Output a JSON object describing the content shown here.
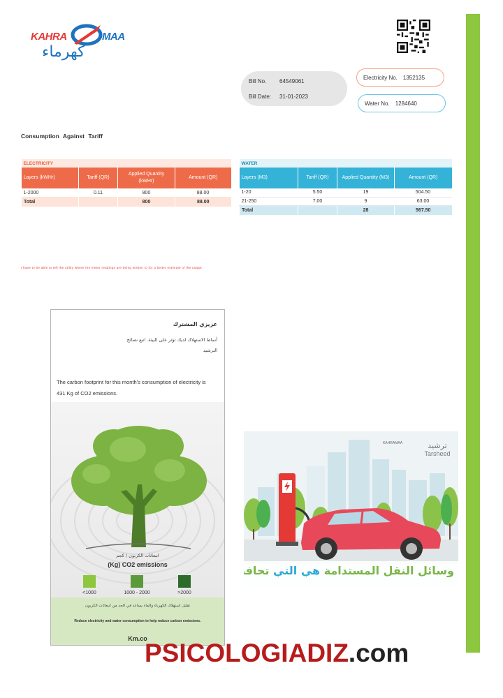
{
  "logo": {
    "kahra": "KAHRA",
    "maa": "MAA",
    "arabic": "كهرماء"
  },
  "bill": {
    "bill_no_label": "Bill No.",
    "bill_no": "64549061",
    "bill_date_label": "Bill Date:",
    "bill_date": "31-01-2023",
    "electricity_no_label": "Electricity No.",
    "electricity_no": "1352135",
    "water_no_label": "Water No.",
    "water_no": "1284640"
  },
  "section_title": "Consumption Against Tariff",
  "electricity": {
    "caption": "ELECTRICITY",
    "headers": [
      "Layers (kWHr)",
      "Tariff (QR)",
      "Applied Quantity (kWHr)",
      "Amount (QR)"
    ],
    "rows": [
      [
        "1-2000",
        "0.11",
        "800",
        "88.00"
      ]
    ],
    "total": [
      "Total",
      "",
      "800",
      "88.00"
    ]
  },
  "water": {
    "caption": "WATER",
    "headers": [
      "Layers (M3)",
      "Tariff (QR)",
      "Applied Quantity (M3)",
      "Amount (QR)"
    ],
    "rows": [
      [
        "1-20",
        "5.50",
        "19",
        "504.50"
      ],
      [
        "21-250",
        "7.00",
        "9",
        "63.00"
      ]
    ],
    "total": [
      "Total",
      "",
      "28",
      "567.50"
    ]
  },
  "note": "I have to be able to tell the utility where the meter readings are being written to for a better estimate of the usage.",
  "carbon_card": {
    "ar_title": "عزيزي المشترك",
    "ar_text": "أنماط الاستهلاك لديك تؤثر على البيئة. اتبع نصائح الترشيد",
    "en_text": "The carbon footprint for this month's consumption of electricity is 431 Kg of CO2 emissions.",
    "emissions_ar": "انبعاثات الكربون / كجم",
    "emissions_en": "(Kg) CO2 emissions",
    "legend": [
      {
        "label": "<1000",
        "color": "#8dc63f"
      },
      {
        "label": "1000 - 2000",
        "color": "#5a9a3a"
      },
      {
        "label": ">2000",
        "color": "#2e6b2a"
      }
    ],
    "foot_ar": "تقليل استهلاك الكهرباء والماء يساعد في الحد من انبعاثات الكربون",
    "foot_en": "Reduce electricity and water consumption to help reduce carbon emissions.",
    "km": "Km.co"
  },
  "ad": {
    "logo1": "KAHRAMAA",
    "logo2_ar": "ترشيد",
    "logo2_en": "Tarsheed",
    "slogan_pre": "وسائل النقل المستدامة",
    "slogan_hl": "هي التي",
    "slogan_post": "تحافظ على البيئة"
  },
  "watermark": {
    "part1": "PSICOLOGIA",
    "part2": "DIZ",
    "part3": ".com"
  },
  "colors": {
    "accent_green": "#8dc63f",
    "electricity_orange": "#ee6b4a",
    "water_blue": "#34b2d7"
  }
}
